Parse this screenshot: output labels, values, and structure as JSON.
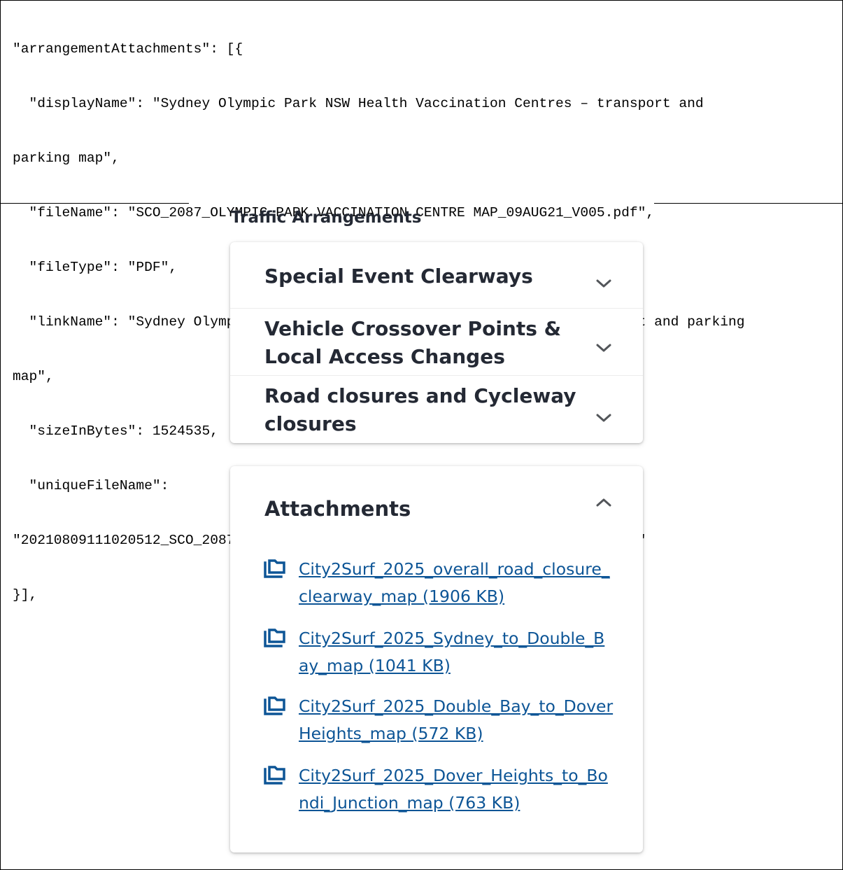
{
  "code_snippet": {
    "lines": [
      "\"arrangementAttachments\": [{",
      "  \"displayName\": \"Sydney Olympic Park NSW Health Vaccination Centres – transport and",
      "parking map\",",
      "  \"fileName\": \"SCO_2087_OLYMPIC PARK VACCINATION CENTRE MAP_09AUG21_V005.pdf\",",
      "  \"fileType\": \"PDF\",",
      "  \"linkName\": \"Sydney Olympic Park NSW Health Vaccination Centres – transport and parking",
      "map\",",
      "  \"sizeInBytes\": 1524535,",
      "  \"uniqueFileName\":",
      "\"20210809111020512_SCO_2087_OLYMPICPARKVACCINATIONCENTREMAP_09AUG21_V005.pdf\"",
      "}],"
    ]
  },
  "section": {
    "title": "Traffic Arrangements"
  },
  "accordion": {
    "items": [
      {
        "label": "Special Event Clearways",
        "icon": "chevron-down-icon"
      },
      {
        "label": "Vehicle Crossover Points & Local Access Changes",
        "icon": "chevron-down-icon"
      },
      {
        "label": "Road closures and Cycleway closures",
        "icon": "chevron-down-icon"
      }
    ]
  },
  "attachments": {
    "title": "Attachments",
    "icon": "chevron-up-icon",
    "link_color": "#0d5596",
    "items": [
      {
        "label": "City2Surf_2025_overall_road_closure_clearway_map (1906 KB)",
        "icon": "file-copy-icon"
      },
      {
        "label": "City2Surf_2025_Sydney_to_Double_Bay_map (1041 KB)",
        "icon": "file-copy-icon"
      },
      {
        "label": "City2Surf_2025_Double_Bay_to_Dover Heights_map (572 KB)",
        "icon": "file-copy-icon"
      },
      {
        "label": "City2Surf_2025_Dover_Heights_to_Bondi_Junction_map (763 KB)",
        "icon": "file-copy-icon"
      }
    ]
  }
}
